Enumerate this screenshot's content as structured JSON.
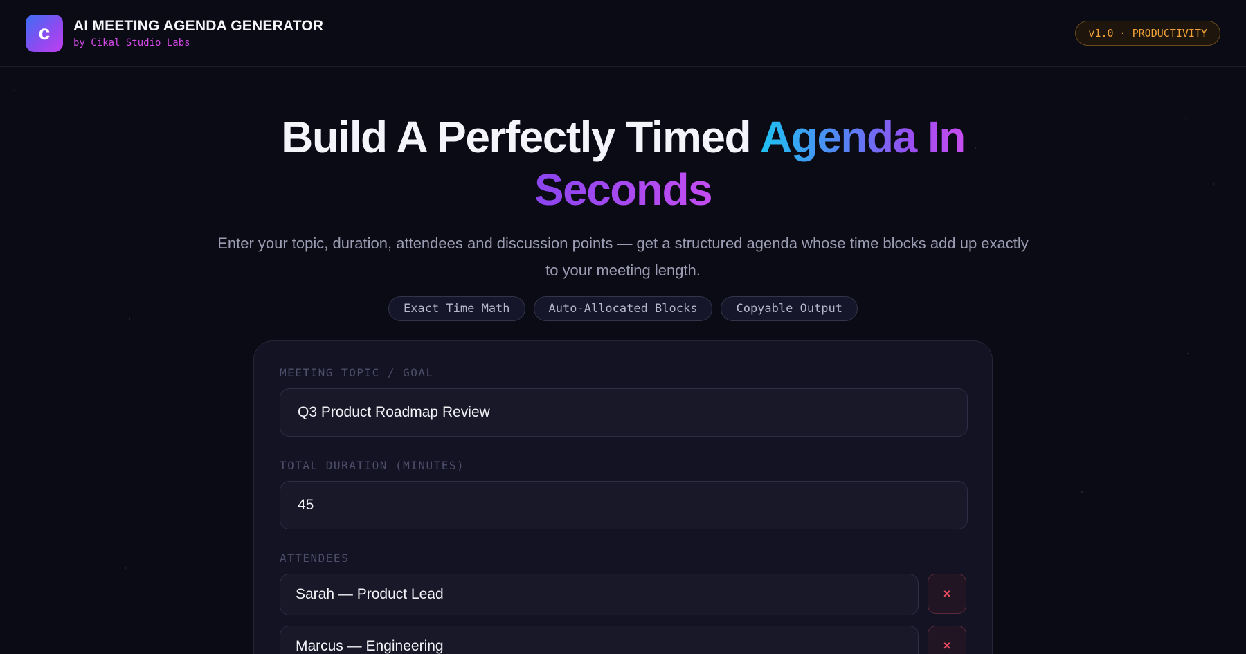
{
  "header": {
    "logo_letter": "c",
    "title": "AI MEETING AGENDA GENERATOR",
    "subtitle": "by Cikal Studio Labs",
    "badge": "v1.0 · PRODUCTIVITY"
  },
  "hero": {
    "title_part1": "Build A Perfectly Timed ",
    "title_highlight1": "Agenda In",
    "title_highlight2": "Seconds",
    "description": "Enter your topic, duration, attendees and discussion points — get a structured agenda whose time blocks add up exactly to your meeting length.",
    "chips": [
      "Exact Time Math",
      "Auto-Allocated Blocks",
      "Copyable Output"
    ]
  },
  "form": {
    "topic_label": "MEETING TOPIC / GOAL",
    "topic_value": "Q3 Product Roadmap Review",
    "duration_label": "TOTAL DURATION (MINUTES)",
    "duration_value": "45",
    "attendees_label": "ATTENDEES",
    "attendees": [
      {
        "value": "Sarah — Product Lead",
        "remove": "×"
      },
      {
        "value": "Marcus — Engineering",
        "remove": "×"
      }
    ]
  },
  "colors": {
    "background": "#0b0b16",
    "accent_cyan": "#1ec2f2",
    "accent_purple": "#c84ef0",
    "badge_orange": "#f2a23a",
    "danger": "#f04d63"
  }
}
